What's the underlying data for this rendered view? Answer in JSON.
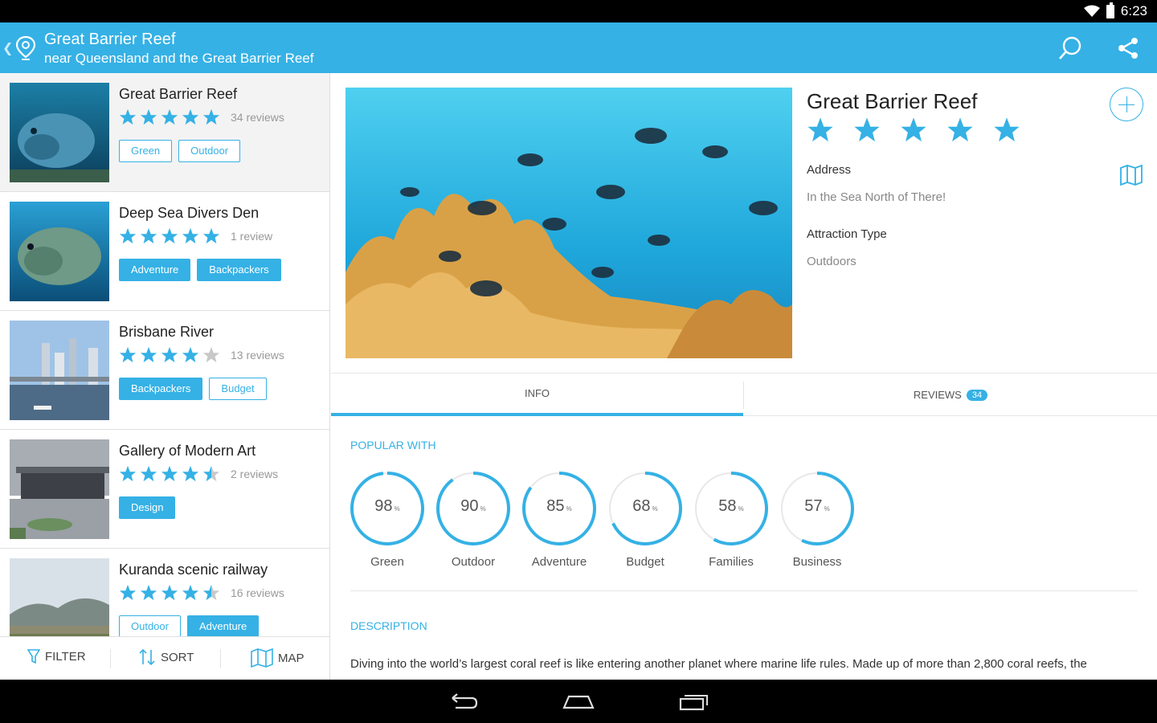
{
  "status": {
    "time": "6:23"
  },
  "actionbar": {
    "title": "Great Barrier Reef",
    "subtitle": "near Queensland and the Great Barrier Reef",
    "icons": [
      "up-chevron-icon",
      "location-pin-icon",
      "search-icon",
      "share-icon"
    ]
  },
  "list": [
    {
      "name": "Great Barrier Reef",
      "rating": 5,
      "reviews": "34 reviews",
      "tags": [
        {
          "label": "Green",
          "filled": false
        },
        {
          "label": "Outdoor",
          "filled": false
        }
      ]
    },
    {
      "name": "Deep Sea Divers Den",
      "rating": 5,
      "reviews": "1 review",
      "tags": [
        {
          "label": "Adventure",
          "filled": true
        },
        {
          "label": "Backpackers",
          "filled": true
        }
      ]
    },
    {
      "name": "Brisbane River",
      "rating": 4,
      "reviews": "13 reviews",
      "tags": [
        {
          "label": "Backpackers",
          "filled": true
        },
        {
          "label": "Budget",
          "filled": false
        }
      ]
    },
    {
      "name": "Gallery of Modern Art",
      "rating": 4.5,
      "reviews": "2 reviews",
      "tags": [
        {
          "label": "Design",
          "filled": true
        }
      ]
    },
    {
      "name": "Kuranda scenic railway",
      "rating": 4.5,
      "reviews": "16 reviews",
      "tags": [
        {
          "label": "Outdoor",
          "filled": false
        },
        {
          "label": "Adventure",
          "filled": true
        }
      ]
    }
  ],
  "bottombar": {
    "filter": "FILTER",
    "sort": "SORT",
    "map": "MAP"
  },
  "detail": {
    "title": "Great Barrier Reef",
    "rating": 5,
    "address_label": "Address",
    "address": "In the Sea North of There!",
    "type_label": "Attraction Type",
    "type": "Outdoors",
    "tabs": {
      "info": "INFO",
      "reviews": "REVIEWS",
      "reviews_count": "34"
    },
    "popular_heading": "POPULAR WITH",
    "popular": [
      {
        "label": "Green",
        "percent": 98
      },
      {
        "label": "Outdoor",
        "percent": 90
      },
      {
        "label": "Adventure",
        "percent": 85
      },
      {
        "label": "Budget",
        "percent": 68
      },
      {
        "label": "Families",
        "percent": 58
      },
      {
        "label": "Business",
        "percent": 57
      }
    ],
    "description_heading": "DESCRIPTION",
    "description": "Diving into the world’s largest coral reef is like entering another planet where marine life rules. Made up of more than 2,800 coral reefs, the"
  },
  "colors": {
    "accent": "#35b1e5",
    "star_empty": "#c8c8c8",
    "ring_track": "#e8e8e8"
  }
}
